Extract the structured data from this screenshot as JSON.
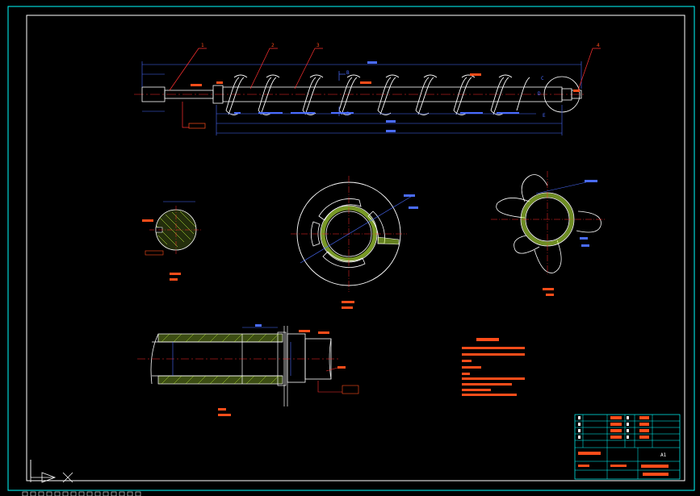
{
  "drawing": {
    "balloons": [
      "1",
      "2",
      "3",
      "4"
    ],
    "section_marks": {
      "b_top": "B",
      "b_bottom": "B",
      "c": "C",
      "d": "D",
      "e": "E"
    },
    "sheet_size": "A1"
  },
  "colors": {
    "background": "#000000",
    "frame": "#00ffff",
    "outline": "#ffffff",
    "dimension": "#4a6cff",
    "center": "#ff2a2a",
    "label": "#ff4d1a",
    "hatch": "#c8ff40",
    "leader": "#ff3030"
  },
  "icons": {
    "ucs": "ucs-axis-icon",
    "cursor": "crosshair-cursor-icon"
  }
}
